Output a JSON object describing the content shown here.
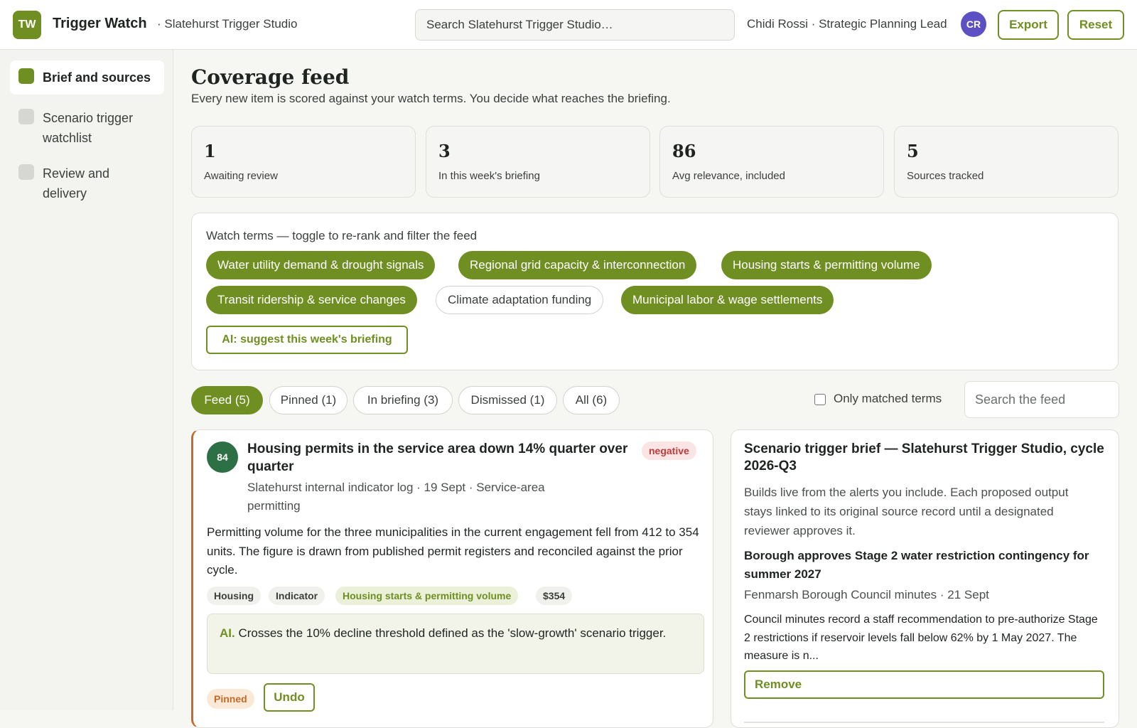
{
  "header": {
    "logo": "TW",
    "app_title": "Trigger Watch",
    "org": "· Slatehurst Trigger Studio",
    "search_placeholder": "Search Slatehurst Trigger Studio…",
    "user": "Chidi Rossi · Strategic Planning Lead",
    "avatar_initials": "CR",
    "export_label": "Export",
    "reset_label": "Reset"
  },
  "sidebar": {
    "items": [
      {
        "label": "Brief and sources",
        "active": true
      },
      {
        "label": "Scenario trigger watchlist",
        "active": false
      },
      {
        "label": "Review and delivery",
        "active": false
      }
    ]
  },
  "main": {
    "title": "Coverage feed",
    "subtitle": "Every new item is scored against your watch terms. You decide what reaches the briefing."
  },
  "stats": [
    {
      "value": "1",
      "label": "Awaiting review"
    },
    {
      "value": "3",
      "label": "In this week's briefing"
    },
    {
      "value": "86",
      "label": "Avg relevance, included"
    },
    {
      "value": "5",
      "label": "Sources tracked"
    }
  ],
  "watch_terms": {
    "heading": "Watch terms — toggle to re-rank and filter the feed",
    "terms": [
      {
        "label": "Water utility demand & drought signals",
        "on": true
      },
      {
        "label": "Regional grid capacity & interconnection",
        "on": true
      },
      {
        "label": "Housing starts & permitting volume",
        "on": true
      },
      {
        "label": "Transit ridership & service changes",
        "on": true
      },
      {
        "label": "Climate adaptation funding",
        "on": false
      },
      {
        "label": "Municipal labor & wage settlements",
        "on": true
      }
    ],
    "ai_suggest_label": "AI: suggest this week's briefing"
  },
  "feed_tabs": [
    {
      "label": "Feed (5)",
      "active": true
    },
    {
      "label": "Pinned (1)",
      "active": false
    },
    {
      "label": "In briefing (3)",
      "active": false
    },
    {
      "label": "Dismissed (1)",
      "active": false
    },
    {
      "label": "All (6)",
      "active": false
    }
  ],
  "filters": {
    "only_matched_label": "Only matched terms",
    "only_matched_checked": false,
    "search_placeholder": "Search the feed"
  },
  "feed_card": {
    "score": "84",
    "title": "Housing permits in the service area down 14% quarter over quarter",
    "sentiment": "negative",
    "meta": "Slatehurst internal indicator log · 19 Sept · Service-area permitting",
    "body": "Permitting volume for the three municipalities in the current engagement fell from 412 to 354 units. The figure is drawn from published permit registers and reconciled against the prior cycle.",
    "tags": [
      "Housing",
      "Indicator",
      "Housing starts & permitting volume",
      "$354"
    ],
    "ai_label": "AI.",
    "ai_text": " Crosses the 10% decline threshold defined as the 'slow-growth' scenario trigger.",
    "pinned_label": "Pinned",
    "undo_label": "Undo",
    "colors": {
      "accent": "#c46a2a",
      "score": "#2e7046"
    }
  },
  "brief": {
    "title": "Scenario trigger brief — Slatehurst Trigger Studio, cycle 2026-Q3",
    "description": "Builds live from the alerts you include. Each proposed output stays linked to its original source record until a designated reviewer approves it.",
    "item": {
      "title": "Borough approves Stage 2 water restriction contingency for summer 2027",
      "meta": "Fenmarsh Borough Council minutes · 21 Sept",
      "body": "Council minutes record a staff recommendation to pre-authorize Stage 2 restrictions if reservoir levels fall below 62% by 1 May 2027. The measure is n...",
      "remove_label": "Remove"
    }
  },
  "colors": {
    "brand": "#6f8f22",
    "avatar": "#5d4fc4",
    "negative": "#c23a3a"
  }
}
